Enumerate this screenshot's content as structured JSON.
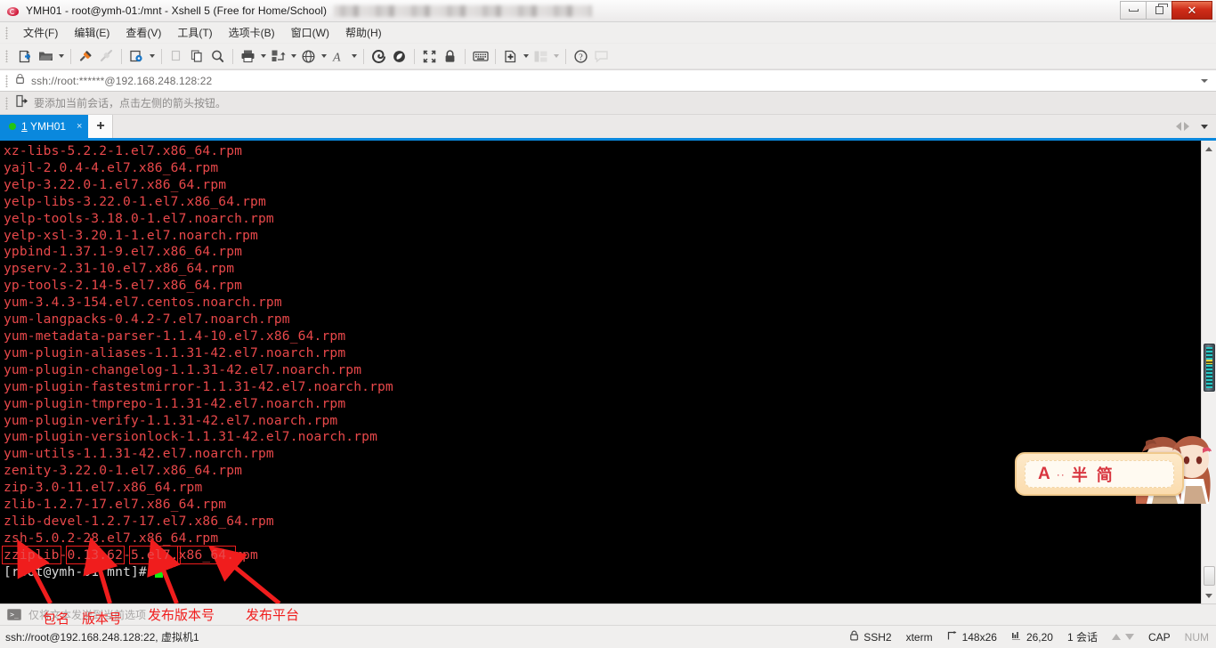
{
  "window": {
    "title": "YMH01 - root@ymh-01:/mnt - Xshell 5 (Free for Home/School)",
    "controls": {
      "minimize": "minimize",
      "maximize": "maximize",
      "close": "✕"
    }
  },
  "menu": {
    "items": [
      {
        "label": "文件(F)",
        "name": "menu-file"
      },
      {
        "label": "编辑(E)",
        "name": "menu-edit"
      },
      {
        "label": "查看(V)",
        "name": "menu-view"
      },
      {
        "label": "工具(T)",
        "name": "menu-tools"
      },
      {
        "label": "选项卡(B)",
        "name": "menu-tabs"
      },
      {
        "label": "窗口(W)",
        "name": "menu-window"
      },
      {
        "label": "帮助(H)",
        "name": "menu-help"
      }
    ]
  },
  "toolbar": {
    "icons": [
      "new-session-icon",
      "open-folder-icon",
      "connect-icon",
      "disconnect-icon",
      "session-properties-icon",
      "copy-icon",
      "paste-icon",
      "find-icon",
      "print-icon",
      "transfer-icon",
      "browser-icon",
      "font-icon",
      "xshell-icon",
      "xftp-icon",
      "fullscreen-icon",
      "lock-icon",
      "keyboard-icon",
      "compose-pane-icon",
      "layout-icon",
      "help-icon",
      "chat-icon"
    ]
  },
  "address": {
    "value": "ssh://root:******@192.168.248.128:22",
    "lock_icon": "lock-icon",
    "dropdown_icon": "chevron-down-icon"
  },
  "hint": {
    "icon": "add-session-icon",
    "text": "要添加当前会话，点击左侧的箭头按钮。"
  },
  "tabs": {
    "active": {
      "index": "1",
      "label": "YMH01",
      "status": "connected",
      "close": "×"
    },
    "new_tab": "+",
    "nav": {
      "prev": "prev-tab",
      "next": "next-tab",
      "list": "tab-list"
    }
  },
  "terminal": {
    "lines": [
      "xz-libs-5.2.2-1.el7.x86_64.rpm",
      "yajl-2.0.4-4.el7.x86_64.rpm",
      "yelp-3.22.0-1.el7.x86_64.rpm",
      "yelp-libs-3.22.0-1.el7.x86_64.rpm",
      "yelp-tools-3.18.0-1.el7.noarch.rpm",
      "yelp-xsl-3.20.1-1.el7.noarch.rpm",
      "ypbind-1.37.1-9.el7.x86_64.rpm",
      "ypserv-2.31-10.el7.x86_64.rpm",
      "yp-tools-2.14-5.el7.x86_64.rpm",
      "yum-3.4.3-154.el7.centos.noarch.rpm",
      "yum-langpacks-0.4.2-7.el7.noarch.rpm",
      "yum-metadata-parser-1.1.4-10.el7.x86_64.rpm",
      "yum-plugin-aliases-1.1.31-42.el7.noarch.rpm",
      "yum-plugin-changelog-1.1.31-42.el7.noarch.rpm",
      "yum-plugin-fastestmirror-1.1.31-42.el7.noarch.rpm",
      "yum-plugin-tmprepo-1.1.31-42.el7.noarch.rpm",
      "yum-plugin-verify-1.1.31-42.el7.noarch.rpm",
      "yum-plugin-versionlock-1.1.31-42.el7.noarch.rpm",
      "yum-utils-1.1.31-42.el7.noarch.rpm",
      "zenity-3.22.0-1.el7.x86_64.rpm",
      "zip-3.0-11.el7.x86_64.rpm",
      "zlib-1.2.7-17.el7.x86_64.rpm",
      "zlib-devel-1.2.7-17.el7.x86_64.rpm",
      "zsh-5.0.2-28.el7.x86_64.rpm"
    ],
    "highlighted_line": {
      "segments": [
        {
          "text": "zziplib",
          "boxed": true
        },
        {
          "text": "-",
          "boxed": false
        },
        {
          "text": "0.13.62",
          "boxed": true
        },
        {
          "text": "-",
          "boxed": false
        },
        {
          "text": "5.el7.",
          "boxed": true
        },
        {
          "text": "x86_64.",
          "boxed": true
        },
        {
          "text": "rpm",
          "boxed": false
        }
      ]
    },
    "prompt": "[root@ymh-01 mnt]# ",
    "text_color": "#e8484a",
    "prompt_color": "#d8d8d8",
    "cursor_color": "#11ef11",
    "background": "#000000"
  },
  "annotations": {
    "highlight_color": "#f01d1d",
    "labels": [
      {
        "text": "包名",
        "name": "annotation-package-name"
      },
      {
        "text": "版本号",
        "name": "annotation-version"
      },
      {
        "text": "发布版本号",
        "name": "annotation-release"
      },
      {
        "text": "发布平台",
        "name": "annotation-platform"
      }
    ]
  },
  "ime": {
    "mode_letter": "A",
    "dots": "··",
    "width_mode": "半",
    "script_mode": "简"
  },
  "sendbar": {
    "icon": "terminal-prompt-icon",
    "text": "仅将文本发送到当前选项"
  },
  "statusbar": {
    "connection": "ssh://root@192.168.248.128:22, 虚拟机1",
    "protocol": "SSH2",
    "emulation": "xterm",
    "size": "148x26",
    "cursor": "26,20",
    "sessions": "1 会话",
    "cap": "CAP",
    "num": "NUM"
  }
}
